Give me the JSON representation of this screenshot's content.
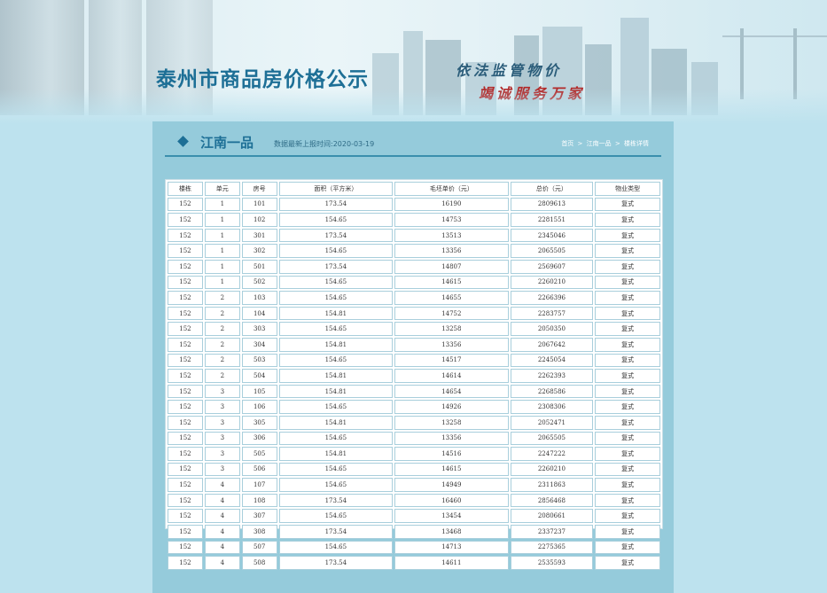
{
  "header": {
    "site_title": "泰州市商品房价格公示",
    "slogan_line1": "依法监管物价",
    "slogan_line2": "竭诚服务万家"
  },
  "panel": {
    "project_name": "江南一品",
    "update_label": "数据最新上报时间:",
    "update_date": "2020-03-19",
    "breadcrumb": [
      "首页",
      "江南一品",
      "楼栋详情"
    ],
    "breadcrumb_sep": ">"
  },
  "table": {
    "headers": [
      "楼栋",
      "单元",
      "房号",
      "面积（平方米）",
      "毛坯单价（元）",
      "总价（元）",
      "物业类型"
    ],
    "rows": [
      [
        "152",
        "1",
        "101",
        "173.54",
        "16190",
        "2809613",
        "复式"
      ],
      [
        "152",
        "1",
        "102",
        "154.65",
        "14753",
        "2281551",
        "复式"
      ],
      [
        "152",
        "1",
        "301",
        "173.54",
        "13513",
        "2345046",
        "复式"
      ],
      [
        "152",
        "1",
        "302",
        "154.65",
        "13356",
        "2065505",
        "复式"
      ],
      [
        "152",
        "1",
        "501",
        "173.54",
        "14807",
        "2569607",
        "复式"
      ],
      [
        "152",
        "1",
        "502",
        "154.65",
        "14615",
        "2260210",
        "复式"
      ],
      [
        "152",
        "2",
        "103",
        "154.65",
        "14655",
        "2266396",
        "复式"
      ],
      [
        "152",
        "2",
        "104",
        "154.81",
        "14752",
        "2283757",
        "复式"
      ],
      [
        "152",
        "2",
        "303",
        "154.65",
        "13258",
        "2050350",
        "复式"
      ],
      [
        "152",
        "2",
        "304",
        "154.81",
        "13356",
        "2067642",
        "复式"
      ],
      [
        "152",
        "2",
        "503",
        "154.65",
        "14517",
        "2245054",
        "复式"
      ],
      [
        "152",
        "2",
        "504",
        "154.81",
        "14614",
        "2262393",
        "复式"
      ],
      [
        "152",
        "3",
        "105",
        "154.81",
        "14654",
        "2268586",
        "复式"
      ],
      [
        "152",
        "3",
        "106",
        "154.65",
        "14926",
        "2308306",
        "复式"
      ],
      [
        "152",
        "3",
        "305",
        "154.81",
        "13258",
        "2052471",
        "复式"
      ],
      [
        "152",
        "3",
        "306",
        "154.65",
        "13356",
        "2065505",
        "复式"
      ],
      [
        "152",
        "3",
        "505",
        "154.81",
        "14516",
        "2247222",
        "复式"
      ],
      [
        "152",
        "3",
        "506",
        "154.65",
        "14615",
        "2260210",
        "复式"
      ],
      [
        "152",
        "4",
        "107",
        "154.65",
        "14949",
        "2311863",
        "复式"
      ],
      [
        "152",
        "4",
        "108",
        "173.54",
        "16460",
        "2856468",
        "复式"
      ],
      [
        "152",
        "4",
        "307",
        "154.65",
        "13454",
        "2080661",
        "复式"
      ],
      [
        "152",
        "4",
        "308",
        "173.54",
        "13468",
        "2337237",
        "复式"
      ],
      [
        "152",
        "4",
        "507",
        "154.65",
        "14713",
        "2275365",
        "复式"
      ],
      [
        "152",
        "4",
        "508",
        "173.54",
        "14611",
        "2535593",
        "复式"
      ]
    ]
  },
  "colors": {
    "title_blue": "#1d6f96",
    "slogan_red": "#b22a2a",
    "panel_bg": "#95cbdb",
    "page_bg": "#bde2ee"
  }
}
